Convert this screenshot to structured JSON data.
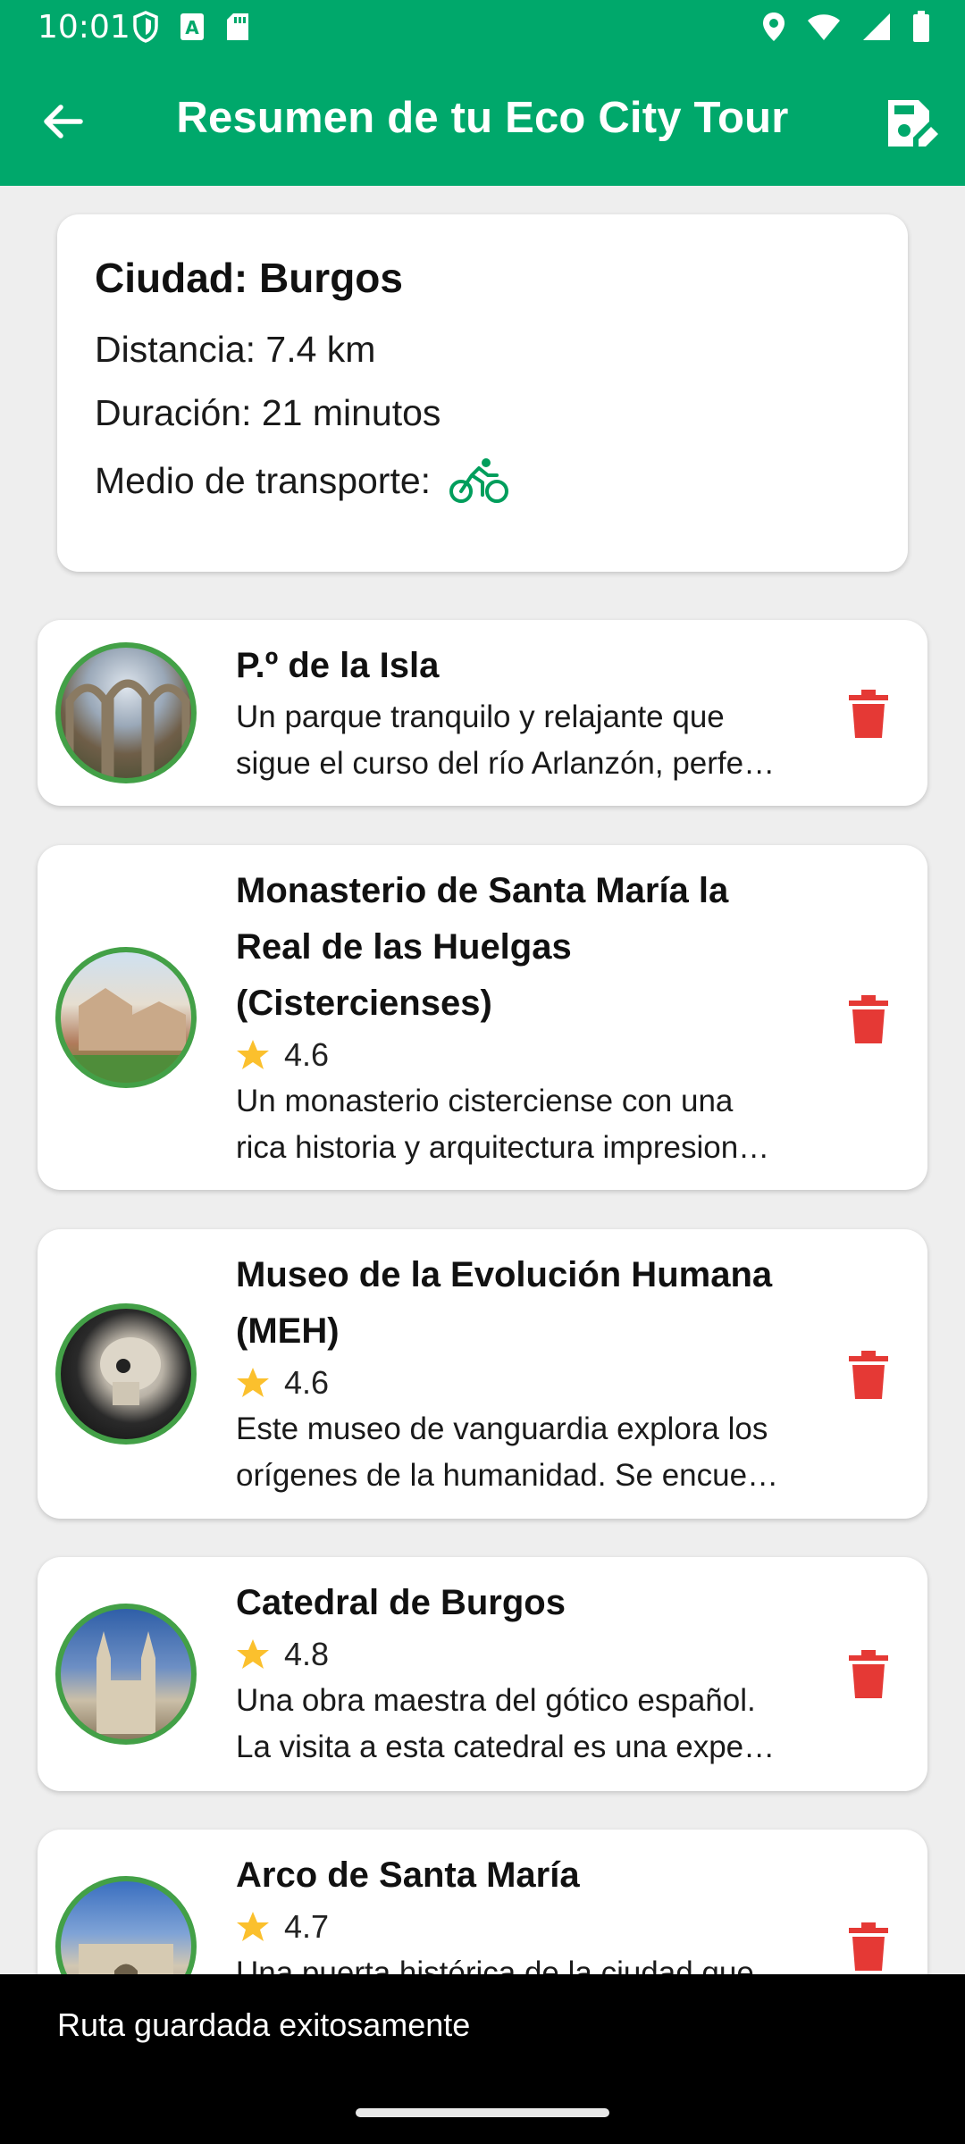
{
  "status_bar": {
    "time": "10:01"
  },
  "app_bar": {
    "title": "Resumen de tu Eco City Tour"
  },
  "summary": {
    "city": "Ciudad: Burgos",
    "distance": "Distancia: 7.4 km",
    "duration": "Duración: 21 minutos",
    "transport_label": "Medio de transporte:",
    "transport_icon": "bicycle-icon"
  },
  "places": [
    {
      "name_lines": [
        "P.º de la Isla"
      ],
      "rating": "",
      "desc": [
        "Un parque tranquilo y relajante que",
        "sigue el curso del río Arlanzón, perfe…"
      ]
    },
    {
      "name_lines": [
        "Monasterio de Santa María la",
        "Real de las Huelgas",
        "(Cistercienses)"
      ],
      "rating": "4.6",
      "desc": [
        "Un monasterio cisterciense con una",
        "rica historia y arquitectura impresion…"
      ]
    },
    {
      "name_lines": [
        "Museo de la Evolución Humana",
        "(MEH)"
      ],
      "rating": "4.6",
      "desc": [
        "Este museo de vanguardia explora los",
        "orígenes de la humanidad. Se encue…"
      ]
    },
    {
      "name_lines": [
        "Catedral de Burgos"
      ],
      "rating": "4.8",
      "desc": [
        "Una obra maestra del gótico español.",
        "La visita a esta catedral es una expe…"
      ]
    },
    {
      "name_lines": [
        "Arco de Santa María"
      ],
      "rating": "4.7",
      "desc": [
        "Una puerta histórica de la ciudad que",
        ""
      ]
    }
  ],
  "snackbar": {
    "message": "Ruta guardada exitosamente"
  },
  "colors": {
    "primary": "#00a86b",
    "delete": "#e53935",
    "star": "#fbc02d",
    "avatar_border": "#43a047"
  }
}
